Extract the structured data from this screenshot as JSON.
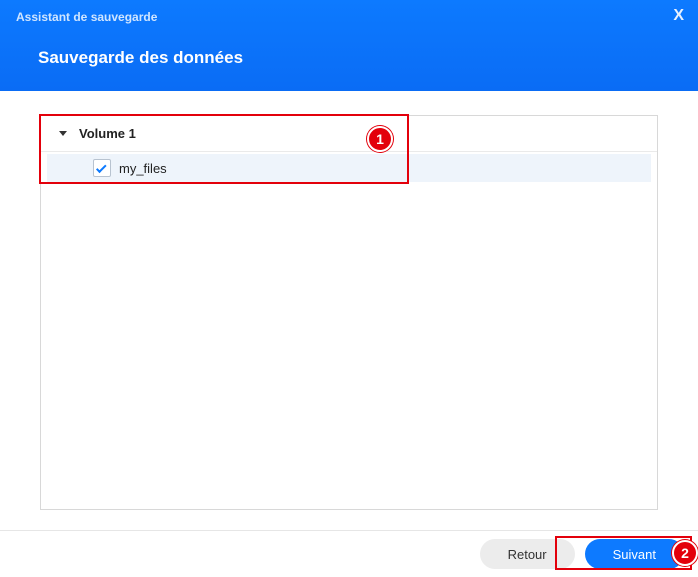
{
  "header": {
    "assistant_label": "Assistant de sauvegarde",
    "title": "Sauvegarde des données",
    "close_symbol": "X"
  },
  "tree": {
    "volume_label": "Volume 1",
    "items": [
      {
        "label": "my_files",
        "checked": true
      }
    ]
  },
  "markers": {
    "m1": "1",
    "m2": "2"
  },
  "footer": {
    "back_label": "Retour",
    "next_label": "Suivant"
  }
}
